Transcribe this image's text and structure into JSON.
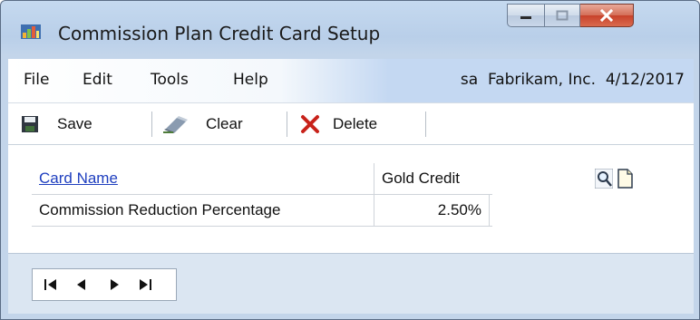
{
  "window": {
    "title": "Commission Plan Credit Card Setup",
    "app_icon": "dynamics-gp-app-icon",
    "controls": {
      "minimize": "minimize-icon",
      "maximize": "maximize-icon",
      "close": "close-icon"
    }
  },
  "menu": {
    "items": [
      "File",
      "Edit",
      "Tools",
      "Help"
    ],
    "context": "sa  Fabrikam, Inc.  4/12/2017"
  },
  "toolbar": {
    "save_label": "Save",
    "clear_label": "Clear",
    "delete_label": "Delete",
    "save_icon": "floppy-disk-icon",
    "clear_icon": "eraser-icon",
    "delete_icon": "red-x-delete-icon"
  },
  "form": {
    "card_name_label": "Card Name",
    "card_name_value": "Gold Credit",
    "commission_label": "Commission Reduction Percentage",
    "commission_value": "2.50%",
    "lookup_icon": "magnifier-lookup-icon",
    "new_icon": "new-document-icon"
  },
  "navigation": [
    "first-record-icon",
    "previous-record-icon",
    "next-record-icon",
    "last-record-icon"
  ],
  "colors": {
    "link": "#1f3fbf",
    "close_button": "#c8422b",
    "window_frame": "#b9cfe9"
  }
}
